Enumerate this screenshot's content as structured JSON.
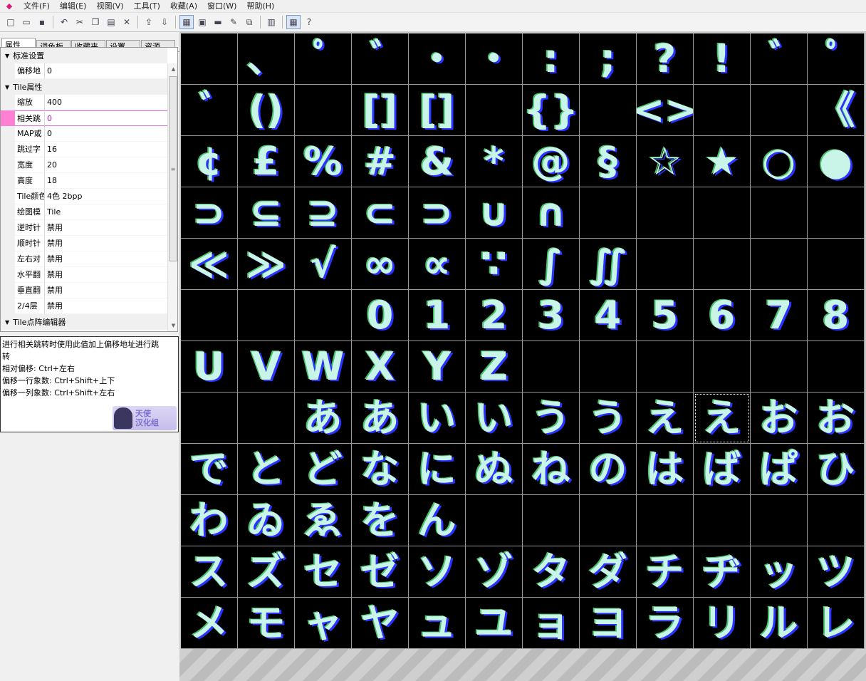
{
  "menu": {
    "logo": "◆",
    "items": [
      "文件(F)",
      "编辑(E)",
      "视图(V)",
      "工具(T)",
      "收藏(A)",
      "窗口(W)",
      "帮助(H)"
    ]
  },
  "toolbar": {
    "buttons": [
      {
        "icon": "new-file-icon",
        "glyph": "□"
      },
      {
        "icon": "open-folder-icon",
        "glyph": "▭"
      },
      {
        "icon": "save-icon",
        "glyph": "▪"
      },
      {
        "icon": "undo-icon",
        "glyph": "↶"
      },
      {
        "icon": "cut-icon",
        "glyph": "✂"
      },
      {
        "icon": "copy-icon",
        "glyph": "❐"
      },
      {
        "icon": "paste-icon",
        "glyph": "▤"
      },
      {
        "icon": "delete-icon",
        "glyph": "✕"
      },
      {
        "icon": "import-icon",
        "glyph": "⇪"
      },
      {
        "icon": "export-icon",
        "glyph": "⇩"
      },
      {
        "icon": "tile-view-icon",
        "glyph": "▦"
      },
      {
        "icon": "hex-view-icon",
        "glyph": "▣"
      },
      {
        "icon": "text-view-icon",
        "glyph": "▬"
      },
      {
        "icon": "edit-text-icon",
        "glyph": "✎"
      },
      {
        "icon": "replace-icon",
        "glyph": "⧉"
      },
      {
        "icon": "print-icon",
        "glyph": "▥"
      },
      {
        "icon": "grid-toggle-icon",
        "glyph": "▦"
      },
      {
        "icon": "help-icon",
        "glyph": "?"
      }
    ]
  },
  "tabs": [
    "属性",
    "调色板",
    "收藏夹",
    "设置",
    "资源"
  ],
  "properties": {
    "section_standard": "标准设置",
    "offset_key": "偏移地",
    "offset_val": "0",
    "section_tile": "Tile属性",
    "zoom_key": "缩放",
    "zoom_val": "400",
    "relative_key": "相关跳",
    "relative_val": "0",
    "map_key": "MAP或",
    "map_val": "0",
    "skip_key": "跳过字",
    "skip_val": "16",
    "width_key": "宽度",
    "width_val": "20",
    "height_key": "高度",
    "height_val": "18",
    "color_key": "Tile颜色",
    "color_val": "4色  2bpp",
    "draw_key": "绘图模",
    "draw_val": "Tile",
    "ccw_key": "逆时针",
    "ccw_val": "禁用",
    "cw_key": "顺时针",
    "cw_val": "禁用",
    "lr_key": "左右对",
    "lr_val": "禁用",
    "hflip_key": "水平翻",
    "hflip_val": "禁用",
    "vflip_key": "垂直翻",
    "vflip_val": "禁用",
    "layer_key": "2/4层",
    "layer_val": "禁用",
    "section_editor": "Tile点阵编辑器"
  },
  "help": {
    "line1": "进行相关跳转时使用此值加上偏移地址进行跳",
    "line2": "转",
    "line3": "相对偏移: Ctrl+左右",
    "line4": "偏移一行象数: Ctrl+Shift+上下",
    "line5": "偏移一列象数: Ctrl+Shift+左右",
    "badge_text1": "天使",
    "badge_text2": "汉化组"
  },
  "tiles": [
    "",
    "、",
    "ﾟ",
    "ﾞ",
    "・",
    "・",
    ":",
    ";",
    "?",
    "!",
    "ﾞ",
    "ﾟ",
    "ﾞ",
    "()",
    "",
    "[]",
    "[]",
    "",
    "{}",
    "",
    "<>",
    "",
    "",
    "《",
    "¢",
    "£",
    "%",
    "#",
    "&",
    "*",
    "@",
    "§",
    "☆",
    "★",
    "○",
    "●",
    "⊃",
    "⊆",
    "⊇",
    "⊂",
    "⊃",
    "∪",
    "∩",
    "",
    "",
    "",
    "",
    "",
    "≪",
    "≫",
    "√",
    "∞",
    "∝",
    "∵",
    "∫",
    "∬",
    "",
    "",
    "",
    "",
    "",
    "",
    "",
    "0",
    "1",
    "2",
    "3",
    "4",
    "5",
    "6",
    "7",
    "8",
    "U",
    "V",
    "W",
    "X",
    "Y",
    "Z",
    "",
    "",
    "",
    "",
    "",
    "",
    "",
    "",
    "あ",
    "あ",
    "い",
    "い",
    "う",
    "う",
    "え",
    "え",
    "お",
    "お",
    "で",
    "と",
    "ど",
    "な",
    "に",
    "ぬ",
    "ね",
    "の",
    "は",
    "ば",
    "ぱ",
    "ひ",
    "わ",
    "ゐ",
    "ゑ",
    "を",
    "ん",
    "",
    "",
    "",
    "",
    "",
    "",
    "",
    "ス",
    "ズ",
    "セ",
    "ゼ",
    "ソ",
    "ゾ",
    "タ",
    "ダ",
    "チ",
    "ヂ",
    "ッ",
    "ツ",
    "メ",
    "モ",
    "ャ",
    "ヤ",
    "ュ",
    "ユ",
    "ョ",
    "ヨ",
    "ラ",
    "リ",
    "ル",
    "レ"
  ],
  "selected_tile_index": 93
}
